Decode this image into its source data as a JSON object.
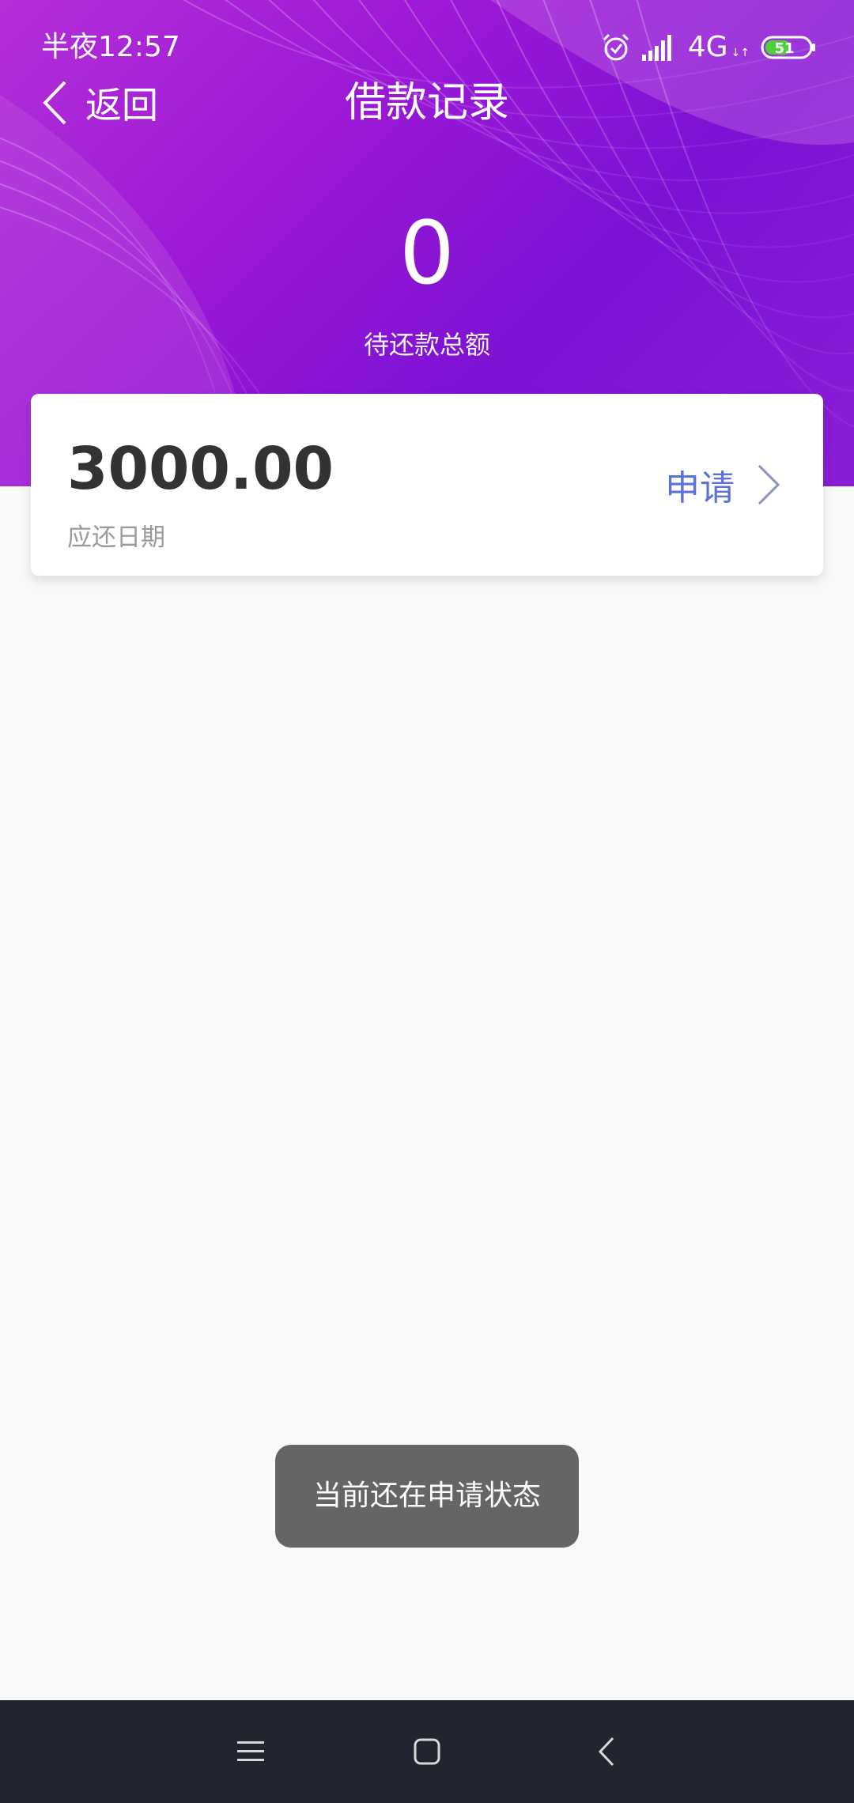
{
  "status_bar": {
    "time": "半夜12:57",
    "network": "4G",
    "network_arrows": "↓↑",
    "battery": "51",
    "icons": [
      "alarm-icon",
      "signal-icon",
      "battery-icon"
    ]
  },
  "nav": {
    "back_label": "返回",
    "title": "借款记录"
  },
  "summary": {
    "pending_amount": "0",
    "pending_label": "待还款总额"
  },
  "loan_card": {
    "amount": "3000.00",
    "due_label": "应还日期",
    "status_label": "申请"
  },
  "toast": {
    "message": "当前还在申请状态"
  },
  "system_nav": {
    "icons": [
      "menu-icon",
      "home-icon",
      "back-icon"
    ]
  },
  "colors": {
    "header_start": "#b42fd8",
    "header_end": "#7d12d3",
    "accent_link": "#5b73d8",
    "battery_green": "#4cd137",
    "nav_bar": "#222530",
    "toast_bg": "#656565"
  }
}
